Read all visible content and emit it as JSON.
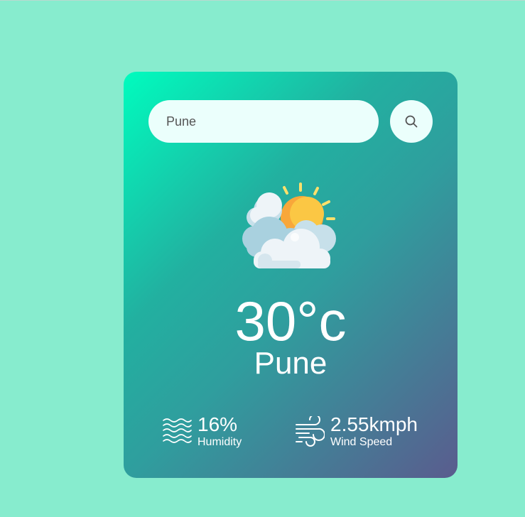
{
  "search": {
    "value": "Pune",
    "button_icon": "search-icon"
  },
  "weather": {
    "condition_icon": "partly-cloudy-sun-icon",
    "temperature": "30°c",
    "city": "Pune"
  },
  "details": {
    "humidity": {
      "value": "16%",
      "label": "Humidity",
      "icon": "humidity-waves-icon"
    },
    "wind": {
      "value": "2.55kmph",
      "label": "Wind Speed",
      "icon": "wind-icon"
    }
  },
  "colors": {
    "page_background": "#87ecce",
    "card_gradient_start": "#00fcbe",
    "card_gradient_end": "#5a5c8e",
    "input_background": "#ebfffc",
    "text": "#ffffff"
  }
}
